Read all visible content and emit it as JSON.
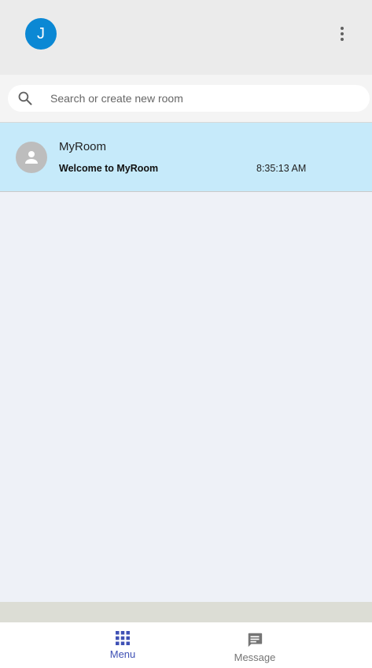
{
  "header": {
    "user_initial": "J",
    "more_icon": "more-vert-icon"
  },
  "search": {
    "placeholder": "Search or create new room",
    "value": "",
    "icon": "search-icon"
  },
  "rooms": [
    {
      "name": "MyRoom",
      "last_message": "Welcome to MyRoom",
      "time": "8:35:13 AM",
      "avatar_icon": "person-icon"
    }
  ],
  "bottom_nav": {
    "items": [
      {
        "label": "Menu",
        "icon": "apps-grid-icon",
        "active": true
      },
      {
        "label": "Message",
        "icon": "message-icon",
        "active": false
      }
    ]
  },
  "colors": {
    "user_avatar": "#0b88d4",
    "selected_room": "#c6eafa",
    "active_nav": "#3f51b5",
    "inactive_nav": "#757575"
  }
}
